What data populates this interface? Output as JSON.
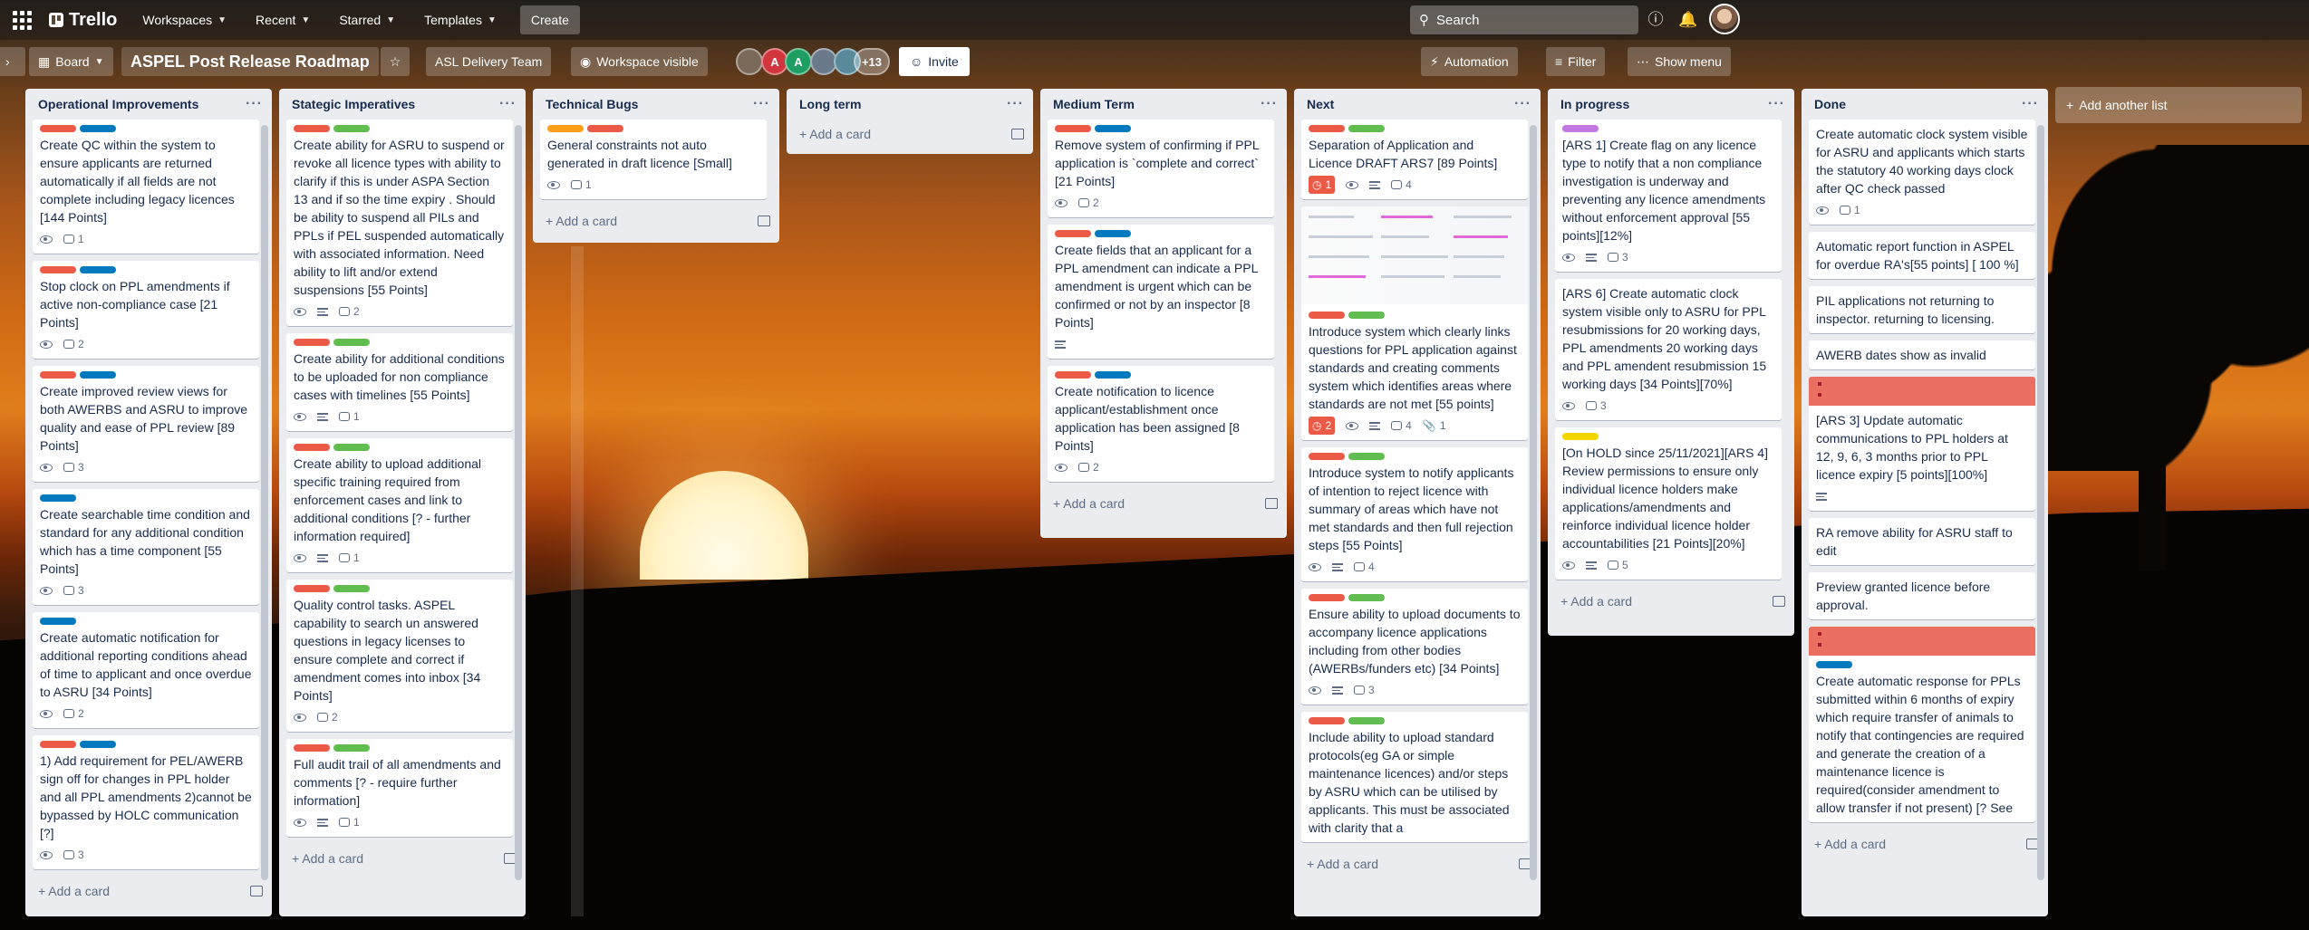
{
  "header": {
    "workspaces": "Workspaces",
    "recent": "Recent",
    "starred": "Starred",
    "templates": "Templates",
    "create": "Create",
    "logo": "Trello",
    "search_placeholder": "Search"
  },
  "board": {
    "view": "Board",
    "name": "ASPEL Post Release Roadmap",
    "team": "ASL Delivery Team",
    "visibility": "Workspace visible",
    "member_count": "+13",
    "invite": "Invite",
    "automation": "Automation",
    "filter": "Filter",
    "show_menu": "Show menu",
    "members": [
      {
        "initial": "",
        "color": "#7a6a5a"
      },
      {
        "initial": "A",
        "color": "#d1363e"
      },
      {
        "initial": "A",
        "color": "#1f9e64"
      },
      {
        "initial": "",
        "color": "#6a7a8a"
      },
      {
        "initial": "",
        "color": "#5a8a9a"
      }
    ]
  },
  "add_card": "Add a card",
  "add_list": "Add another list",
  "colors": {
    "red": "#eb5a46",
    "blue": "#0079bf",
    "green": "#61bd4f",
    "orange": "#ff9f1a",
    "purple": "#c377e0",
    "yellow": "#f2d600"
  },
  "lists": [
    {
      "title": "Operational Improvements",
      "cards": [
        {
          "labels": [
            "red",
            "blue"
          ],
          "text": "Create QC within the system to ensure applicants are returned automatically if all fields are not complete including legacy licences [144 Points]",
          "badges": {
            "watch": true,
            "comments": "1"
          }
        },
        {
          "labels": [
            "red",
            "blue"
          ],
          "text": "Stop clock on PPL amendments if active non-compliance case [21 Points]",
          "badges": {
            "watch": true,
            "comments": "2"
          }
        },
        {
          "labels": [
            "red",
            "blue"
          ],
          "text": "Create improved review views for both AWERBS and ASRU to improve quality and ease of PPL review [89 Points]",
          "badges": {
            "watch": true,
            "comments": "3"
          }
        },
        {
          "labels": [
            "blue"
          ],
          "text": "Create searchable time condition and standard for any additional condition which has a time component [55 Points]",
          "badges": {
            "watch": true,
            "comments": "3"
          }
        },
        {
          "labels": [
            "blue"
          ],
          "text": "Create automatic notification for additional reporting conditions ahead of time to applicant and once overdue to ASRU [34 Points]",
          "badges": {
            "watch": true,
            "comments": "2"
          }
        },
        {
          "labels": [
            "red",
            "blue"
          ],
          "text": "1) Add requirement for PEL/AWERB sign off for changes in PPL holder and all PPL amendments 2)cannot be bypassed by HOLC communication [?]",
          "badges": {
            "watch": true,
            "comments": "3"
          }
        }
      ]
    },
    {
      "title": "Stategic Imperatives",
      "cards": [
        {
          "labels": [
            "red",
            "green"
          ],
          "text": "Create ability for ASRU to suspend or revoke all licence types with ability to clarify if this is under ASPA Section 13 and if so the time expiry . Should be ability to suspend all PILs and PPLs if PEL suspended automatically with associated information. Need ability to lift and/or extend suspensions [55 Points]",
          "badges": {
            "watch": true,
            "desc": true,
            "comments": "2"
          }
        },
        {
          "labels": [
            "red",
            "green"
          ],
          "text": "Create ability for additional conditions to be uploaded for non compliance cases with timelines [55 Points]",
          "badges": {
            "watch": true,
            "desc": true,
            "comments": "1"
          }
        },
        {
          "labels": [
            "red",
            "green"
          ],
          "text": "Create ability to upload additional specific training required from enforcement cases and link to additional conditions [? - further information required]",
          "badges": {
            "watch": true,
            "desc": true,
            "comments": "1"
          }
        },
        {
          "labels": [
            "red",
            "green"
          ],
          "text": "Quality control tasks. ASPEL capability to search un answered questions in legacy licenses to ensure complete and correct if amendment comes into inbox [34 Points]",
          "badges": {
            "watch": true,
            "comments": "2"
          }
        },
        {
          "labels": [
            "red",
            "green"
          ],
          "text": "Full audit trail of all amendments and comments [? - require further information]",
          "badges": {
            "watch": true,
            "desc": true,
            "comments": "1"
          }
        }
      ]
    },
    {
      "title": "Technical Bugs",
      "cards": [
        {
          "labels": [
            "orange",
            "red"
          ],
          "text": "General constraints not auto generated in draft licence [Small]",
          "badges": {
            "watch": true,
            "comments": "1"
          }
        }
      ]
    },
    {
      "title": "Long term",
      "cards": []
    },
    {
      "title": "Medium Term",
      "cards": [
        {
          "labels": [
            "red",
            "blue"
          ],
          "text": "Remove system of confirming if PPL application is `complete and correct` [21 Points]",
          "badges": {
            "watch": true,
            "comments": "2"
          }
        },
        {
          "labels": [
            "red",
            "blue"
          ],
          "text": "Create fields that an applicant for a PPL amendment can indicate a PPL amendment is urgent which can be confirmed or not by an inspector [8 Points]",
          "badges": {
            "desc": true
          }
        },
        {
          "labels": [
            "red",
            "blue"
          ],
          "text": "Create notification to licence applicant/establishment once application has been assigned [8 Points]",
          "badges": {
            "watch": true,
            "comments": "2"
          }
        }
      ]
    },
    {
      "title": "Next",
      "cards": [
        {
          "labels": [
            "red",
            "green"
          ],
          "text": "Separation of Application and Licence DRAFT ARS7 [89 Points]",
          "badges": {
            "due": "1",
            "watch": true,
            "desc": true,
            "comments": "4"
          }
        },
        {
          "labels": [
            "red",
            "green"
          ],
          "thumb": true,
          "text": "Introduce system which clearly links questions for PPL application against standards and creating comments system which identifies areas where standards are not met [55 points]",
          "badges": {
            "due": "2",
            "watch": true,
            "desc": true,
            "comments": "4",
            "attach": "1"
          }
        },
        {
          "labels": [
            "red",
            "green"
          ],
          "text": "Introduce system to notify applicants of intention to reject licence with summary of areas which have not met standards and then full rejection steps [55 Points]",
          "badges": {
            "watch": true,
            "desc": true,
            "comments": "4"
          }
        },
        {
          "labels": [
            "red",
            "green"
          ],
          "text": "Ensure ability to upload documents to accompany licence applications including from other bodies (AWERBs/funders etc) [34 Points]",
          "badges": {
            "watch": true,
            "desc": true,
            "comments": "3"
          }
        },
        {
          "labels": [
            "red",
            "green"
          ],
          "text": "Include ability to upload standard protocols(eg GA or simple maintenance licences) and/or steps by ASRU which can be utilised by applicants. This must be associated with clarity that a",
          "badges": {}
        }
      ]
    },
    {
      "title": "In progress",
      "cards": [
        {
          "labels": [
            "purple"
          ],
          "text": "[ARS 1] Create flag on any licence type to notify that a non compliance investigation is underway and preventing any licence amendments without enforcement approval [55 points][12%]",
          "badges": {
            "watch": true,
            "desc": true,
            "comments": "3"
          }
        },
        {
          "labels": [],
          "text": "[ARS 6] Create automatic clock system visible only to ASRU for PPL resubmissions for 20 working days, PPL amendments 20 working days and PPL amendent resubmission 15 working days [34 Points][70%]",
          "badges": {
            "watch": true,
            "comments": "3"
          }
        },
        {
          "labels": [
            "yellow"
          ],
          "text": "[On HOLD since 25/11/2021][ARS 4] Review permissions to ensure only individual licence holders make applications/amendments and reinforce individual licence holder accountabilities [21 Points][20%]",
          "badges": {
            "watch": true,
            "desc": true,
            "comments": "5"
          }
        }
      ]
    },
    {
      "title": "Done",
      "cards": [
        {
          "labels": [],
          "text": "Create automatic clock system visible for ASRU and applicants which starts the statutory 40 working days clock after QC check passed",
          "badges": {
            "watch": true,
            "comments": "1"
          }
        },
        {
          "labels": [],
          "text": "Automatic report function in ASPEL for overdue RA's[55 points] [ 100 %]",
          "badges": {}
        },
        {
          "labels": [],
          "text": "PIL applications not returning to inspector. returning to licensing.",
          "badges": {}
        },
        {
          "labels": [],
          "text": "AWERB dates show as invalid",
          "badges": {}
        },
        {
          "labels": [],
          "cover": true,
          "text": "[ARS 3] Update automatic communications to PPL holders at 12, 9, 6, 3 months prior to PPL licence expiry [5 points][100%]",
          "badges": {
            "desc": true
          }
        },
        {
          "labels": [],
          "text": "RA remove ability for ASRU staff to edit",
          "badges": {}
        },
        {
          "labels": [],
          "text": "Preview granted licence before approval.",
          "badges": {}
        },
        {
          "labels": [
            "blue"
          ],
          "cover": true,
          "text": "Create automatic response for PPLs submitted within 6 months of expiry which require transfer of animals to notify that contingencies are required and generate the creation of a maintenance licence is required(consider amendment to allow transfer if not present) [? See",
          "badges": {}
        }
      ]
    }
  ]
}
